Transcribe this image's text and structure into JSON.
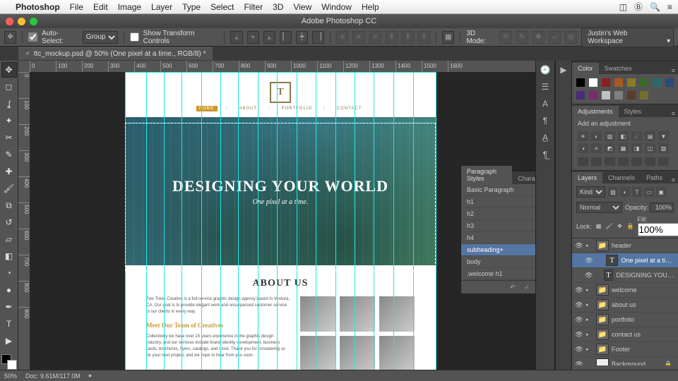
{
  "mac_menu": {
    "apple": "",
    "app": "Photoshop",
    "items": [
      "File",
      "Edit",
      "Image",
      "Layer",
      "Type",
      "Select",
      "Filter",
      "3D",
      "View",
      "Window",
      "Help"
    ]
  },
  "titlebar": "Adobe Photoshop CC",
  "options": {
    "auto_select": "Auto-Select:",
    "group": "Group",
    "show_transform": "Show Transform Controls",
    "mode": "3D Mode:",
    "workspace": "Justin's Web Workspace"
  },
  "doc_tab": {
    "close": "×",
    "label": "ttc_mockup.psd @ 50% (One pixel at a time., RGB/8) *"
  },
  "ruler_h": [
    "0",
    "100",
    "200",
    "300",
    "400",
    "500",
    "600",
    "700",
    "800",
    "900",
    "1000",
    "1100",
    "1200",
    "1300",
    "1400",
    "1500",
    "1600"
  ],
  "ruler_v": [
    "0",
    "100",
    "200",
    "300",
    "400",
    "500",
    "600",
    "700",
    "800",
    "900"
  ],
  "artboard": {
    "nav": {
      "home": "HOME",
      "about": "ABOUT",
      "portfolio": "PORTFOLIO",
      "contact": "CONTACT"
    },
    "hero_h1": "DESIGNING YOUR WORLD",
    "hero_sub": "One pixel at a time.",
    "about_h2": "ABOUT US",
    "about_p1": "Two Trees Creative is a full-service graphic design agency based in Ventura, CA. Our goal is to provide elegant work and unsurpassed customer service to our clients in every way.",
    "about_h3": "Meet Our Team of Creatives",
    "about_p2": "Collectively we have over 15 years experience in the graphic design industry, and our services include brand identity development, business cards, brochures, flyers, catalogs, and more. Thank you for considering us for your next project, and we hope to hear from you soon."
  },
  "paragraph_panel": {
    "tab1": "Paragraph Styles",
    "tab2": "Character",
    "items": [
      "Basic Paragraph",
      "h1",
      "h2",
      "h3",
      "h4",
      "subheading+",
      "body",
      ".welcome h1"
    ],
    "selected": 5
  },
  "panels": {
    "color": "Color",
    "swatches": "Swatches",
    "adjustments": "Adjustments",
    "styles": "Styles",
    "add_adj": "Add an adjustment",
    "layers": "Layers",
    "channels": "Channels",
    "paths": "Paths"
  },
  "layers": {
    "kind": "Kind",
    "blend": "Normal",
    "opacity_l": "Opacity:",
    "opacity_v": "100%",
    "lock_l": "Lock:",
    "fill_l": "Fill:",
    "fill_v": "100%",
    "items": [
      {
        "eye": "👁",
        "disc": "▸",
        "type": "folder",
        "name": "header",
        "indent": 0
      },
      {
        "eye": "👁",
        "disc": "",
        "type": "T",
        "name": "One pixel at a time.",
        "indent": 1,
        "sel": true
      },
      {
        "eye": "👁",
        "disc": "",
        "type": "T",
        "name": "DESIGNING YOUR WORLD",
        "indent": 1
      },
      {
        "eye": "👁",
        "disc": "▸",
        "type": "folder",
        "name": "welcome",
        "indent": 0
      },
      {
        "eye": "👁",
        "disc": "▸",
        "type": "folder",
        "name": "about us",
        "indent": 0
      },
      {
        "eye": "👁",
        "disc": "▸",
        "type": "folder",
        "name": "portfolio",
        "indent": 0
      },
      {
        "eye": "👁",
        "disc": "▸",
        "type": "folder",
        "name": "contact us",
        "indent": 0
      },
      {
        "eye": "👁",
        "disc": "▸",
        "type": "folder",
        "name": "Footer",
        "indent": 0
      },
      {
        "eye": "👁",
        "disc": "",
        "type": "bg",
        "name": "Background",
        "indent": 0,
        "lock": "🔒"
      }
    ]
  },
  "status": {
    "zoom": "50%",
    "doc": "Doc: 9.61M/117.0M"
  },
  "swatches": [
    "#000000",
    "#ffffff",
    "#8a1f1f",
    "#a85a1f",
    "#8a7a2a",
    "#3a6a2a",
    "#2a6a6a",
    "#2a4a7a",
    "#4a2a7a",
    "#7a2a6a",
    "#c0c0c0",
    "#808080",
    "#5a3a2a",
    "#707030"
  ]
}
